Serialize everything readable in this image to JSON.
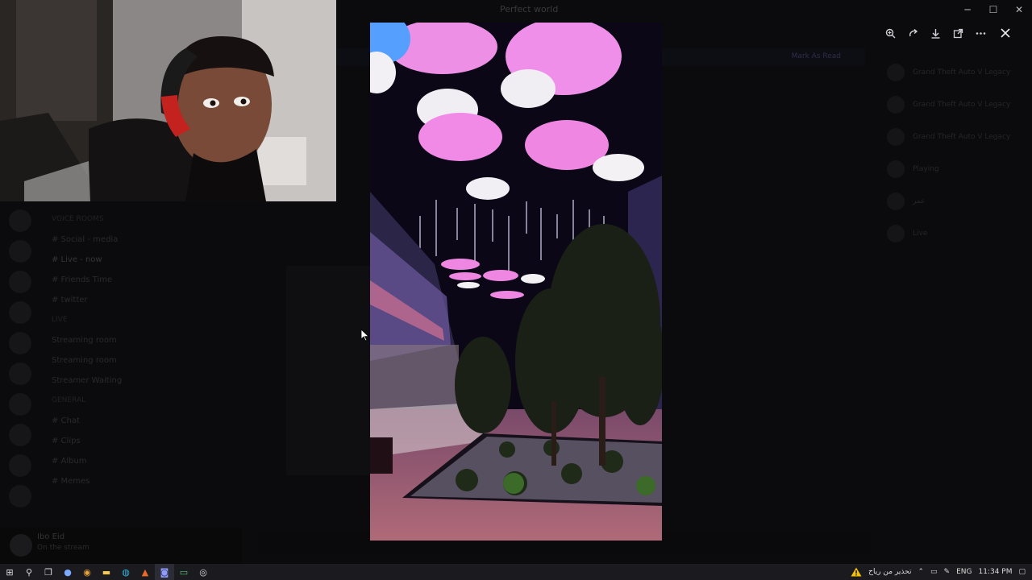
{
  "window": {
    "title": "Perfect world"
  },
  "window_controls": {
    "minimize": "─",
    "maximize": "☐",
    "close": "✕"
  },
  "server": {
    "categories": [
      "VOICE ROOMS",
      "LIVE",
      "GENERAL"
    ],
    "channels": [
      {
        "label": "# Social - media"
      },
      {
        "label": "# Live - now"
      },
      {
        "label": "# Friends Time"
      },
      {
        "label": "# twitter"
      },
      {
        "label": "Streaming room"
      },
      {
        "label": "Streaming room"
      },
      {
        "label": "Streamer Waiting"
      },
      {
        "label": "# Chat"
      },
      {
        "label": "# Clips"
      },
      {
        "label": "# Album"
      },
      {
        "label": "# Memes"
      }
    ]
  },
  "user_panel": {
    "name": "Ibo Eid",
    "status": "On the stream"
  },
  "topbar": {
    "mark": "Mark As Read"
  },
  "members": [
    "Grand Theft Auto V Legacy",
    "Grand Theft Auto V Legacy",
    "Grand Theft Auto V Legacy",
    "Playing",
    "عمر",
    "Live"
  ],
  "taskbar": {
    "icons": [
      {
        "name": "windows-start-icon",
        "glyph": "⊞"
      },
      {
        "name": "search-icon",
        "glyph": "⚲"
      },
      {
        "name": "task-view-icon",
        "glyph": "❐"
      },
      {
        "name": "copilot-icon",
        "glyph": "●"
      },
      {
        "name": "chrome-icon",
        "glyph": "◉"
      },
      {
        "name": "file-explorer-icon",
        "glyph": "▬"
      },
      {
        "name": "edge-icon",
        "glyph": "◍"
      },
      {
        "name": "app-icon",
        "glyph": "▲"
      },
      {
        "name": "discord-icon",
        "glyph": "◙"
      },
      {
        "name": "terminal-icon",
        "glyph": "▭"
      },
      {
        "name": "obs-icon",
        "glyph": "◎"
      }
    ],
    "warning_text": "تحذير من رياح",
    "language": "ENG",
    "time": "11:34 PM"
  },
  "colors": {
    "taskbar": "#1a1a1f",
    "accent_pink": "#e879d8"
  }
}
